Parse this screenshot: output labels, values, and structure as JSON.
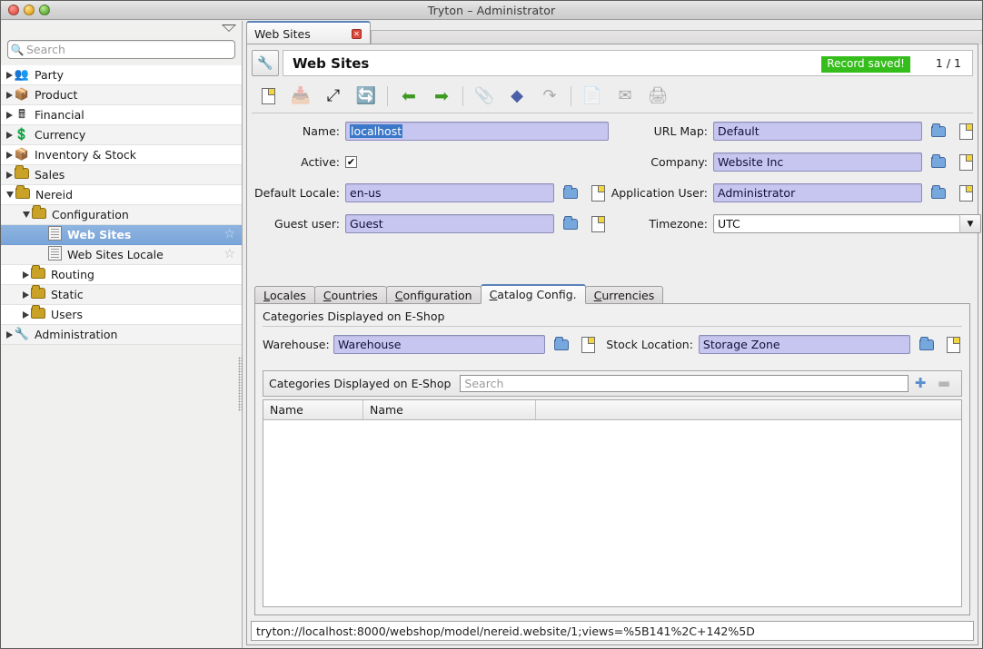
{
  "window": {
    "title": "Tryton – Administrator",
    "traffic_lights": [
      "close-button",
      "minimize-button",
      "zoom-button"
    ]
  },
  "sidebar": {
    "search": {
      "placeholder": "Search",
      "value": "",
      "icon": "search-icon"
    },
    "collapse_icon": "chevron-down-icon",
    "items": [
      {
        "label": "Party",
        "indent": 0,
        "state": "collapsed",
        "icon": "party-icon",
        "selected": false,
        "star": false
      },
      {
        "label": "Product",
        "indent": 0,
        "state": "collapsed",
        "icon": "product-icon",
        "selected": false,
        "star": false
      },
      {
        "label": "Financial",
        "indent": 0,
        "state": "collapsed",
        "icon": "financial-icon",
        "selected": false,
        "star": false
      },
      {
        "label": "Currency",
        "indent": 0,
        "state": "collapsed",
        "icon": "currency-icon",
        "selected": false,
        "star": false
      },
      {
        "label": "Inventory & Stock",
        "indent": 0,
        "state": "collapsed",
        "icon": "inventory-icon",
        "selected": false,
        "star": false
      },
      {
        "label": "Sales",
        "indent": 0,
        "state": "collapsed",
        "icon": "folder-icon",
        "selected": false,
        "star": false
      },
      {
        "label": "Nereid",
        "indent": 0,
        "state": "expanded",
        "icon": "folder-icon",
        "selected": false,
        "star": false
      },
      {
        "label": "Configuration",
        "indent": 1,
        "state": "expanded",
        "icon": "folder-icon",
        "selected": false,
        "star": false
      },
      {
        "label": "Web Sites",
        "indent": 2,
        "state": "leaf",
        "icon": "list-icon",
        "selected": true,
        "star": true
      },
      {
        "label": "Web Sites Locale",
        "indent": 2,
        "state": "leaf",
        "icon": "list-icon",
        "selected": false,
        "star": true
      },
      {
        "label": "Routing",
        "indent": 1,
        "state": "collapsed",
        "icon": "folder-icon",
        "selected": false,
        "star": false
      },
      {
        "label": "Static",
        "indent": 1,
        "state": "collapsed",
        "icon": "folder-icon",
        "selected": false,
        "star": false
      },
      {
        "label": "Users",
        "indent": 1,
        "state": "collapsed",
        "icon": "folder-icon",
        "selected": false,
        "star": false
      },
      {
        "label": "Administration",
        "indent": 0,
        "state": "collapsed",
        "icon": "tools-icon",
        "selected": false,
        "star": false
      }
    ]
  },
  "window_tab": {
    "label": "Web Sites",
    "close_icon": "close-icon"
  },
  "header": {
    "icon": "tools-icon",
    "title": "Web Sites",
    "status_badge": "Record saved!",
    "status_badge_color": "#35bd1c",
    "record_count": "1 / 1"
  },
  "toolbar": {
    "buttons": [
      {
        "name": "new-record-button",
        "icon": "new-document-icon",
        "enabled": true
      },
      {
        "name": "save-record-button",
        "icon": "save-icon",
        "enabled": false
      },
      {
        "name": "switch-view-button",
        "icon": "fullscreen-icon",
        "enabled": true
      },
      {
        "name": "reload-button",
        "icon": "reload-icon",
        "enabled": true
      },
      {
        "name": "previous-button",
        "icon": "arrow-left-icon",
        "enabled": true
      },
      {
        "name": "next-button",
        "icon": "arrow-right-icon",
        "enabled": true
      },
      {
        "name": "attachment-button",
        "icon": "paperclip-icon",
        "enabled": false
      },
      {
        "name": "action-button",
        "icon": "diamond-icon",
        "enabled": true
      },
      {
        "name": "relate-button",
        "icon": "undo-icon",
        "enabled": false
      },
      {
        "name": "report-button",
        "icon": "report-icon",
        "enabled": false
      },
      {
        "name": "email-button",
        "icon": "email-icon",
        "enabled": false
      },
      {
        "name": "print-button",
        "icon": "print-icon",
        "enabled": false
      }
    ]
  },
  "form": {
    "left": [
      {
        "label": "Name:",
        "value": "localhost",
        "type": "text",
        "selected": true,
        "open": false,
        "new": false
      },
      {
        "label": "Active:",
        "value": "✔",
        "type": "checkbox",
        "checked": true
      },
      {
        "label": "Default Locale:",
        "value": "en-us",
        "type": "m2o",
        "selected": false,
        "open": true,
        "new": true
      },
      {
        "label": "Guest user:",
        "value": "Guest",
        "type": "m2o",
        "selected": false,
        "open": true,
        "new": true
      }
    ],
    "right": [
      {
        "label": "URL Map:",
        "value": "Default",
        "type": "m2o",
        "open": true,
        "new": true
      },
      {
        "label": "Company:",
        "value": "Website Inc",
        "type": "m2o",
        "open": true,
        "new": true
      },
      {
        "label": "Application User:",
        "value": "Administrator",
        "type": "m2o",
        "open": true,
        "new": true
      },
      {
        "label": "Timezone:",
        "value": "UTC",
        "type": "combobox",
        "open": false,
        "new": false
      }
    ]
  },
  "notebook": {
    "tabs": [
      {
        "mnemonic": "L",
        "rest": "ocales",
        "active": false
      },
      {
        "mnemonic": "C",
        "rest": "ountries",
        "active": false
      },
      {
        "mnemonic": "C",
        "rest": "onfiguration",
        "active": false
      },
      {
        "mnemonic": "C",
        "rest": "atalog Config.",
        "active": true
      },
      {
        "mnemonic": "C",
        "rest": "urrencies",
        "active": false
      }
    ],
    "group_label": "Categories Displayed on E-Shop",
    "warehouse": {
      "label": "Warehouse:",
      "value": "Warehouse"
    },
    "stock_location": {
      "label": "Stock Location:",
      "value": "Storage Zone"
    },
    "one2many": {
      "title": "Categories Displayed on E-Shop",
      "search_placeholder": "Search",
      "search_value": "",
      "add_icon": "plus-icon",
      "remove_icon": "minus-icon",
      "columns": [
        "Name",
        "Name",
        ""
      ],
      "rows": []
    }
  },
  "statusbar": {
    "url": "tryton://localhost:8000/webshop/model/nereid.website/1;views=%5B141%2C+142%5D"
  }
}
